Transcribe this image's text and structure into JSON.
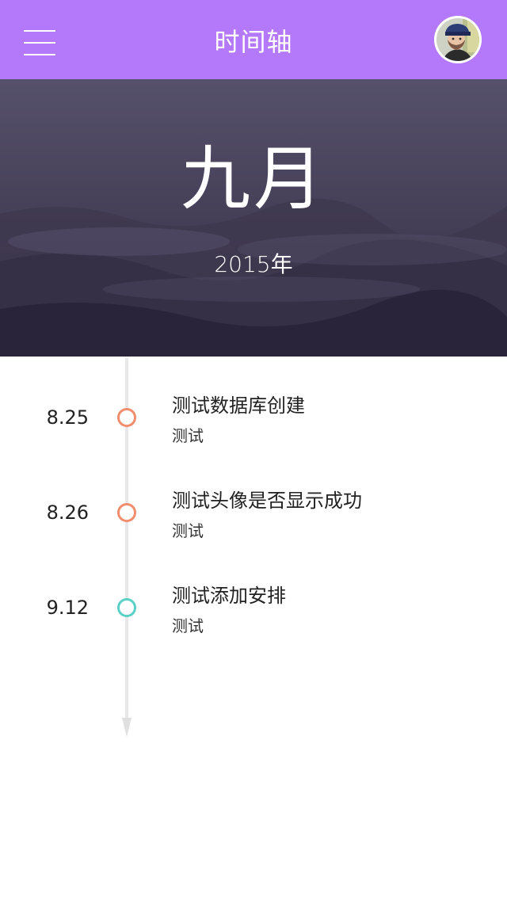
{
  "header": {
    "title": "时间轴",
    "menu_icon": "hamburger-menu-icon",
    "avatar_icon": "user-avatar",
    "background_color": "#b478fb"
  },
  "hero": {
    "month": "九月",
    "year": "2015年",
    "overlay_color": "#4a4258"
  },
  "timeline": {
    "line_color": "#e8e8e8",
    "entries": [
      {
        "date": "8.25",
        "title": "测试数据库创建",
        "subtitle": "测试",
        "dot_color": "#ef8d6c"
      },
      {
        "date": "8.26",
        "title": "测试头像是否显示成功",
        "subtitle": "测试",
        "dot_color": "#ef8d6c"
      },
      {
        "date": "9.12",
        "title": "测试添加安排",
        "subtitle": "测试",
        "dot_color": "#5ad1c6"
      }
    ]
  }
}
